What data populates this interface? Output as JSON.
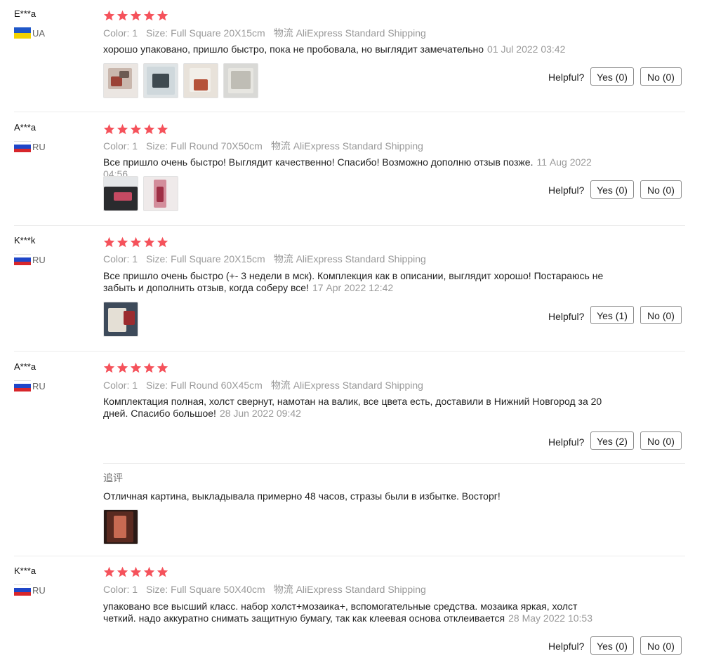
{
  "labels": {
    "color": "Color:",
    "size": "Size:",
    "shipping_prefix": "物流",
    "helpful": "Helpful?",
    "followup": "追评"
  },
  "colors": {
    "star": "#f5525b",
    "muted": "#999999"
  },
  "reviews": [
    {
      "user": "E***a",
      "country": "UA",
      "stars": 5,
      "color": "1",
      "size": "Full Square 20X15cm",
      "shipping": "AliExpress Standard Shipping",
      "text": "хорошо упаковано, пришло быстро, пока не пробовала, но выглядит замечательно",
      "date": "01 Jul 2022 03:42",
      "yes": "Yes (0)",
      "no": "No (0)"
    },
    {
      "user": "A***a",
      "country": "RU",
      "stars": 5,
      "color": "1",
      "size": "Full Round 70X50cm",
      "shipping": "AliExpress Standard Shipping",
      "text": "Все пришло очень быстро! Выглядит качественно! Спасибо! Возможно дополню отзыв позже.",
      "date": "11 Aug 2022 04:56",
      "yes": "Yes (0)",
      "no": "No (0)"
    },
    {
      "user": "K***k",
      "country": "RU",
      "stars": 5,
      "color": "1",
      "size": "Full Square 20X15cm",
      "shipping": "AliExpress Standard Shipping",
      "text": "Все пришло очень быстро (+- 3 недели в мск). Комплекция как в описании, выглядит хорошо! Постараюсь не забыть и дополнить отзыв, когда соберу все!",
      "date": "17 Apr 2022 12:42",
      "yes": "Yes (1)",
      "no": "No (0)"
    },
    {
      "user": "A***a",
      "country": "RU",
      "stars": 5,
      "color": "1",
      "size": "Full Round 60X45cm",
      "shipping": "AliExpress Standard Shipping",
      "text": "Комплектация полная, холст свернут, намотан на валик, все цвета есть, доставили в Нижний Новгород за 20 дней. Спасибо большое!",
      "date": "28 Jun 2022 09:42",
      "yes": "Yes (2)",
      "no": "No (0)",
      "followup_text": "Отличная картина, выкладывала примерно 48 часов, стразы были в избытке. Восторг!"
    },
    {
      "user": "K***a",
      "country": "RU",
      "stars": 5,
      "color": "1",
      "size": "Full Square 50X40cm",
      "shipping": "AliExpress Standard Shipping",
      "text": "упаковано все высший класс. набор холст+мозаика+, вспомогательные средства. мозаика яркая, холст четкий. надо аккуратно снимать защитную бумагу, так как клеевая основа отклеивается",
      "date": "28 May 2022 10:53",
      "yes": "Yes (0)",
      "no": "No (0)"
    }
  ]
}
